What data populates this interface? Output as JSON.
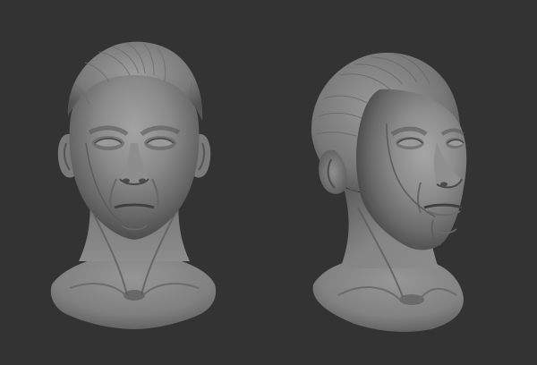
{
  "scene": {
    "subject": "two-sculpted-head-busts",
    "background_color": "#333333",
    "material_colors": {
      "highlight": "#9e9e9e",
      "mid": "#777777",
      "shadow": "#3f3f3f",
      "deep_shadow": "#2a2a2a"
    },
    "views": [
      {
        "name": "front-view"
      },
      {
        "name": "three-quarter-view"
      }
    ]
  }
}
